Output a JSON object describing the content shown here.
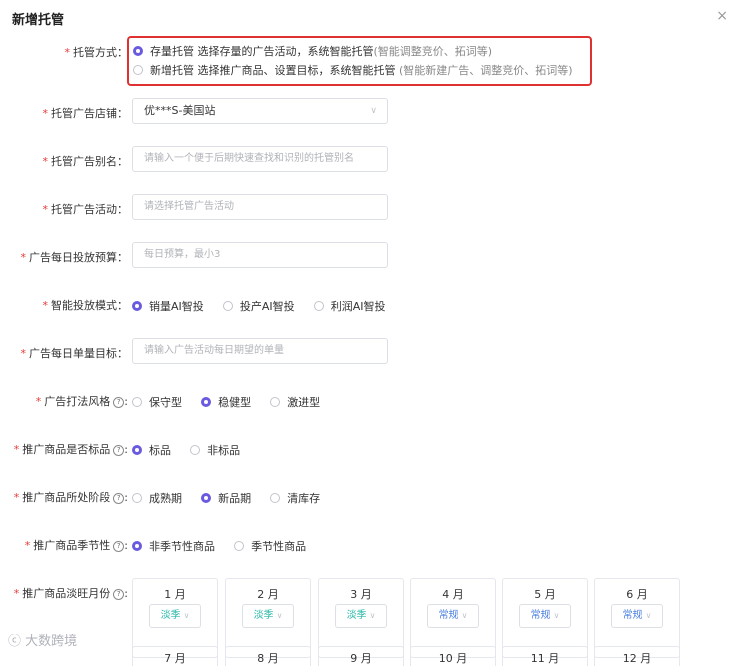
{
  "dialog": {
    "title": "新增托管",
    "close": "×"
  },
  "mode": {
    "label": "托管方式：",
    "options": [
      {
        "text": "存量托管  选择存量的广告活动，系统智能托管",
        "hint": "(智能调整竞价、拓词等)",
        "selected": true
      },
      {
        "text": "新增托管  选择推广商品、设置目标，系统智能托管",
        "hint": "(智能新建广告、调整竞价、拓词等)",
        "selected": false
      }
    ]
  },
  "store": {
    "label": "托管广告店铺：",
    "value": "优***S-美国站"
  },
  "alias": {
    "label": "托管广告别名：",
    "placeholder": "请输入一个便于后期快速查找和识别的托管别名"
  },
  "campaign": {
    "label": "托管广告活动：",
    "placeholder": "请选择托管广告活动"
  },
  "budget": {
    "label": "广告每日投放预算：",
    "placeholder": "每日预算，最小3"
  },
  "smart_mode": {
    "label": "智能投放模式：",
    "options": [
      "销量AI智投",
      "投产AI智投",
      "利润AI智投"
    ],
    "selected": 0
  },
  "order_goal": {
    "label": "广告每日单量目标：",
    "placeholder": "请输入广告活动每日期望的单量"
  },
  "style": {
    "label": "广告打法风格",
    "options": [
      "保守型",
      "稳健型",
      "激进型"
    ],
    "selected": 1
  },
  "standard": {
    "label": "推广商品是否标品",
    "options": [
      "标品",
      "非标品"
    ],
    "selected": 0
  },
  "stage": {
    "label": "推广商品所处阶段",
    "options": [
      "成熟期",
      "新品期",
      "清库存"
    ],
    "selected": 1
  },
  "seasonal": {
    "label": "推广商品季节性",
    "options": [
      "非季节性商品",
      "季节性商品"
    ],
    "selected": 0
  },
  "months": {
    "label": "推广商品淡旺月份",
    "items": [
      {
        "name": "1  月",
        "season": "淡季"
      },
      {
        "name": "2  月",
        "season": "淡季"
      },
      {
        "name": "3  月",
        "season": "淡季"
      },
      {
        "name": "4  月",
        "season": "常规"
      },
      {
        "name": "5  月",
        "season": "常规"
      },
      {
        "name": "6  月",
        "season": "常规"
      }
    ],
    "second_row": [
      "7  月",
      "8  月",
      "9  月",
      "10  月",
      "11  月",
      "12  月"
    ]
  },
  "watermark": "大数跨境"
}
